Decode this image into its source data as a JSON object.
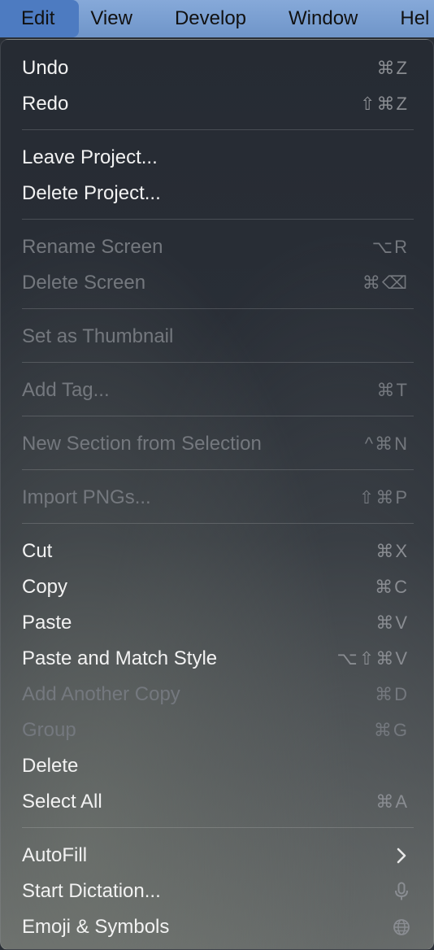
{
  "menubar": {
    "items": [
      "Edit",
      "View",
      "Develop",
      "Window",
      "Hel"
    ]
  },
  "menu": {
    "undo": {
      "label": "Undo",
      "shortcut": "⌘Z"
    },
    "redo": {
      "label": "Redo",
      "shortcut": "⇧⌘Z"
    },
    "leave_project": {
      "label": "Leave Project..."
    },
    "delete_project": {
      "label": "Delete Project..."
    },
    "rename_screen": {
      "label": "Rename Screen",
      "shortcut": "⌥R"
    },
    "delete_screen": {
      "label": "Delete Screen",
      "shortcut": "⌘⌫"
    },
    "set_thumbnail": {
      "label": "Set as Thumbnail"
    },
    "add_tag": {
      "label": "Add Tag...",
      "shortcut": "⌘T"
    },
    "new_section": {
      "label": "New Section from Selection",
      "shortcut": "^⌘N"
    },
    "import_pngs": {
      "label": "Import PNGs...",
      "shortcut": "⇧⌘P"
    },
    "cut": {
      "label": "Cut",
      "shortcut": "⌘X"
    },
    "copy": {
      "label": "Copy",
      "shortcut": "⌘C"
    },
    "paste": {
      "label": "Paste",
      "shortcut": "⌘V"
    },
    "paste_match": {
      "label": "Paste and Match Style",
      "shortcut": "⌥⇧⌘V"
    },
    "add_copy": {
      "label": "Add Another Copy",
      "shortcut": "⌘D"
    },
    "group": {
      "label": "Group",
      "shortcut": "⌘G"
    },
    "delete": {
      "label": "Delete"
    },
    "select_all": {
      "label": "Select All",
      "shortcut": "⌘A"
    },
    "autofill": {
      "label": "AutoFill"
    },
    "dictation": {
      "label": "Start Dictation..."
    },
    "emoji": {
      "label": "Emoji & Symbols"
    }
  },
  "icons": [
    "chevron-right-icon",
    "microphone-icon",
    "globe-icon"
  ],
  "colors": {
    "menubar": "#7b9fd2",
    "active_menu": "#4d7bc1",
    "menu_bg": "#2a2f36",
    "enabled_text": "#f2f2f2",
    "disabled_text": "#74787e"
  }
}
